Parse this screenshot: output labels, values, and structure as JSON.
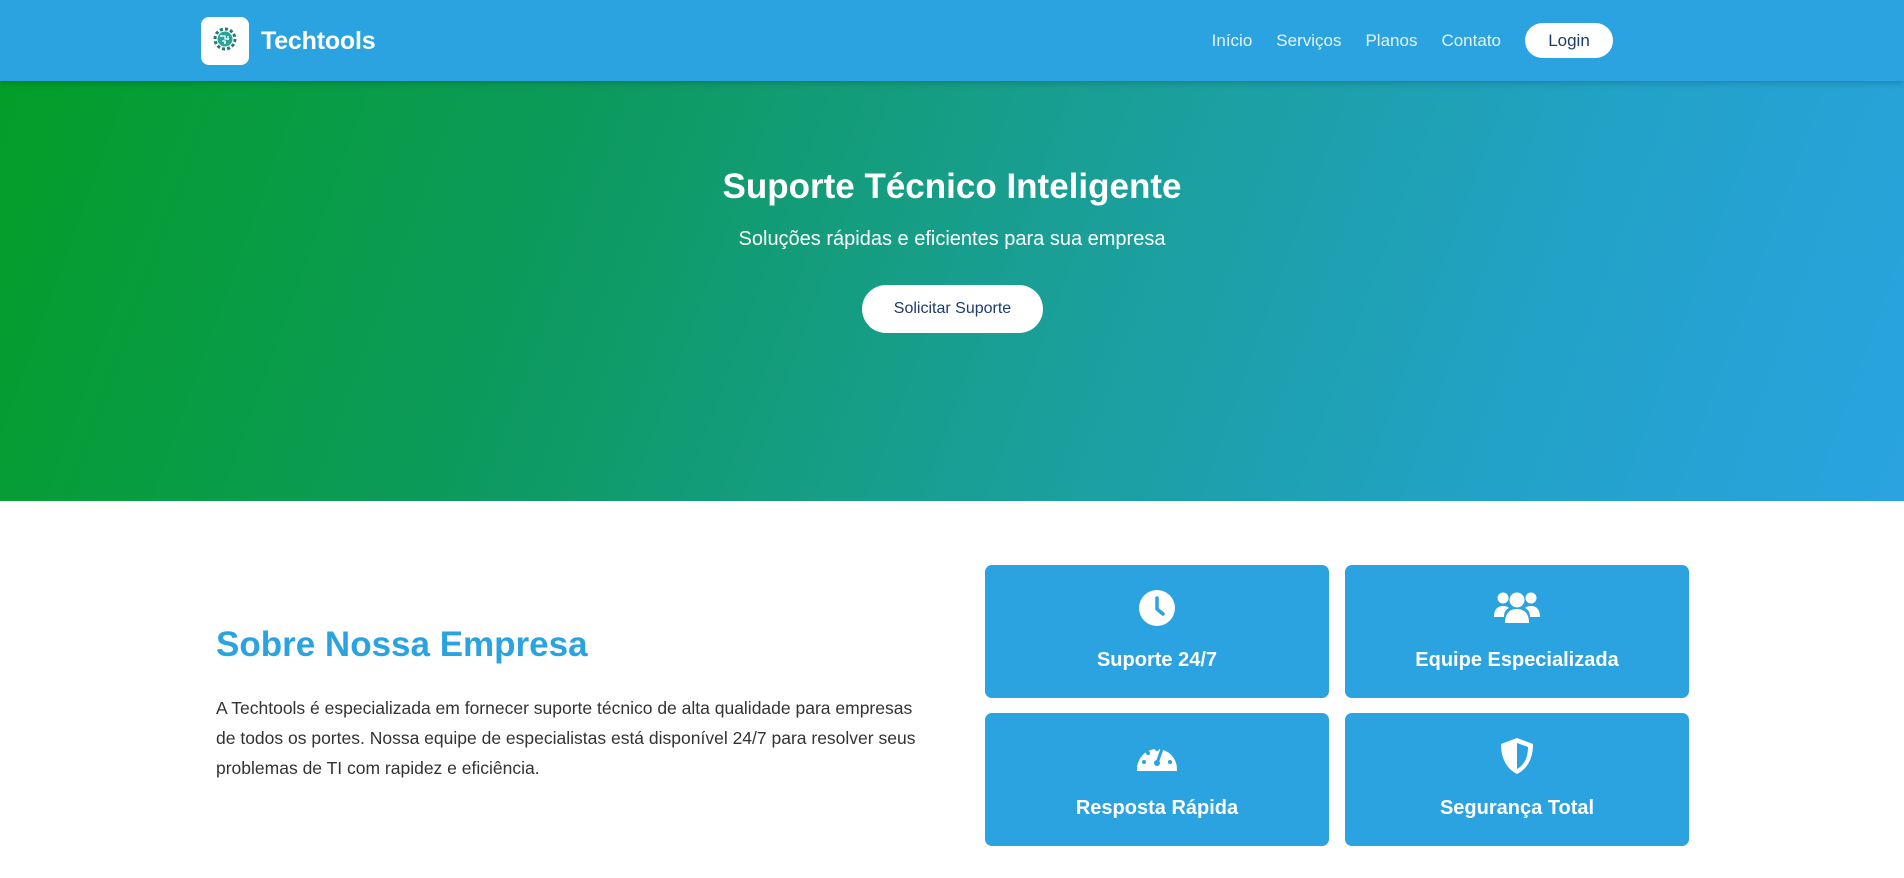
{
  "brand": {
    "name": "Techtools",
    "logo_icon": "circuit-gear-icon"
  },
  "nav": {
    "items": [
      {
        "label": "Início"
      },
      {
        "label": "Serviços"
      },
      {
        "label": "Planos"
      },
      {
        "label": "Contato"
      }
    ],
    "login_label": "Login"
  },
  "hero": {
    "title": "Suporte Técnico Inteligente",
    "subtitle": "Soluções rápidas e eficientes para sua empresa",
    "cta_label": "Solicitar Suporte"
  },
  "about": {
    "title": "Sobre Nossa Empresa",
    "text": "A Techtools é especializada em fornecer suporte técnico de alta qualidade para empresas de todos os portes. Nossa equipe de especialistas está disponível 24/7 para resolver seus problemas de TI com rapidez e eficiência."
  },
  "features": [
    {
      "label": "Suporte 24/7",
      "icon": "clock-icon"
    },
    {
      "label": "Equipe Especializada",
      "icon": "users-icon"
    },
    {
      "label": "Resposta Rápida",
      "icon": "speedometer-icon"
    },
    {
      "label": "Segurança Total",
      "icon": "shield-icon"
    }
  ],
  "colors": {
    "primary": "#2aa3e0",
    "hero_gradient_start": "#039e28",
    "hero_gradient_end": "#2aa3e0",
    "button_text": "#1d3b6b"
  }
}
